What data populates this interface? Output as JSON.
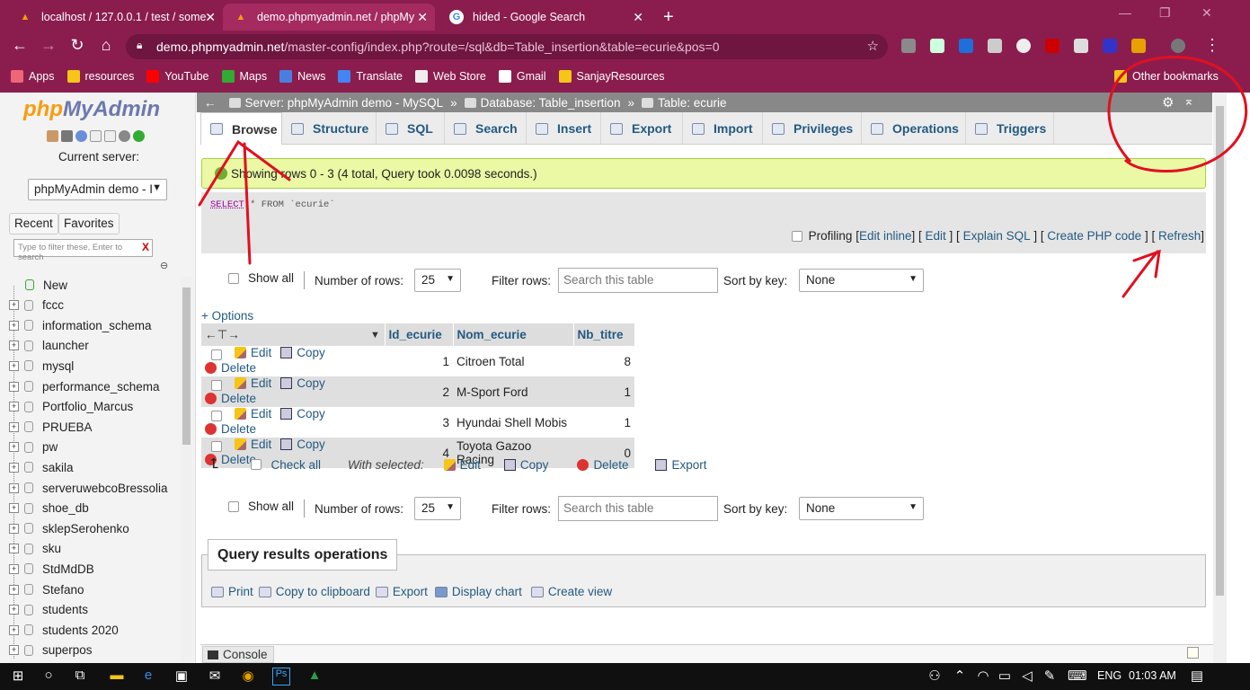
{
  "browser": {
    "tabs": [
      {
        "title": "localhost / 127.0.0.1 / test / some",
        "active": false
      },
      {
        "title": "demo.phpmyadmin.net / phpMy",
        "active": true
      },
      {
        "title": "hided - Google Search",
        "active": false
      }
    ],
    "new_tab": "+",
    "url_host": "demo.phpmyadmin.net",
    "url_path": "/master-config/index.php?route=/sql&db=Table_insertion&table=ecurie&pos=0",
    "bookmarks": [
      "Apps",
      "resources",
      "YouTube",
      "Maps",
      "News",
      "Translate",
      "Web Store",
      "Gmail",
      "SanjayResources"
    ],
    "other_bookmarks": "Other bookmarks"
  },
  "nav": {
    "logo_a": "php",
    "logo_b": "MyAdmin",
    "current_server_label": "Current server:",
    "server_select": "phpMyAdmin demo - I",
    "recent": "Recent",
    "favorites": "Favorites",
    "filter_placeholder": "Type to filter these, Enter to search",
    "databases": [
      "New",
      "fccc",
      "information_schema",
      "launcher",
      "mysql",
      "performance_schema",
      "Portfolio_Marcus",
      "PRUEBA",
      "pw",
      "sakila",
      "serveruwebcoBressolia",
      "shoe_db",
      "sklepSerohenko",
      "sku",
      "StdMdDB",
      "Stefano",
      "students",
      "students 2020",
      "superpos"
    ]
  },
  "breadcrumb": {
    "server": "Server: phpMyAdmin demo - MySQL",
    "database": "Database: Table_insertion",
    "table": "Table: ecurie"
  },
  "tabs": [
    "Browse",
    "Structure",
    "SQL",
    "Search",
    "Insert",
    "Export",
    "Import",
    "Privileges",
    "Operations",
    "Triggers"
  ],
  "success_message": "Showing rows 0 - 3 (4 total, Query took 0.0098 seconds.)",
  "sql": {
    "keyword": "SELECT",
    "rest": " * FROM `ecurie`"
  },
  "sql_links": {
    "profiling": "Profiling",
    "edit_inline": "Edit inline",
    "edit": "Edit",
    "explain": "Explain SQL",
    "create_php": "Create PHP code",
    "refresh": "Refresh"
  },
  "controls": {
    "show_all": "Show all",
    "number_of_rows_label": "Number of rows:",
    "number_of_rows": "25",
    "filter_rows_label": "Filter rows:",
    "filter_placeholder": "Search this table",
    "sort_by_key_label": "Sort by key:",
    "sort_by_key": "None"
  },
  "options_link": "+ Options",
  "table": {
    "columns": [
      "Id_ecurie",
      "Nom_ecurie",
      "Nb_titre"
    ],
    "action_labels": {
      "edit": "Edit",
      "copy": "Copy",
      "delete": "Delete"
    },
    "rows": [
      {
        "id": "1",
        "nom": "Citroen Total",
        "nb": "8"
      },
      {
        "id": "2",
        "nom": "M-Sport Ford",
        "nb": "1"
      },
      {
        "id": "3",
        "nom": "Hyundai Shell Mobis",
        "nb": "1"
      },
      {
        "id": "4",
        "nom": "Toyota Gazoo Racing",
        "nb": "0"
      }
    ]
  },
  "with_selected": {
    "check_all": "Check all",
    "label": "With selected:",
    "edit": "Edit",
    "copy": "Copy",
    "delete": "Delete",
    "export": "Export"
  },
  "query_ops": {
    "title": "Query results operations",
    "print": "Print",
    "copy_clipboard": "Copy to clipboard",
    "export": "Export",
    "display_chart": "Display chart",
    "create_view": "Create view"
  },
  "console": "Console",
  "taskbar": {
    "lang": "ENG",
    "time": "01:03 AM"
  },
  "colors": {
    "chrome": "#8b1d4e",
    "link": "#235a81",
    "success_bg": "#ebf8a4",
    "annotation": "#e01020"
  }
}
